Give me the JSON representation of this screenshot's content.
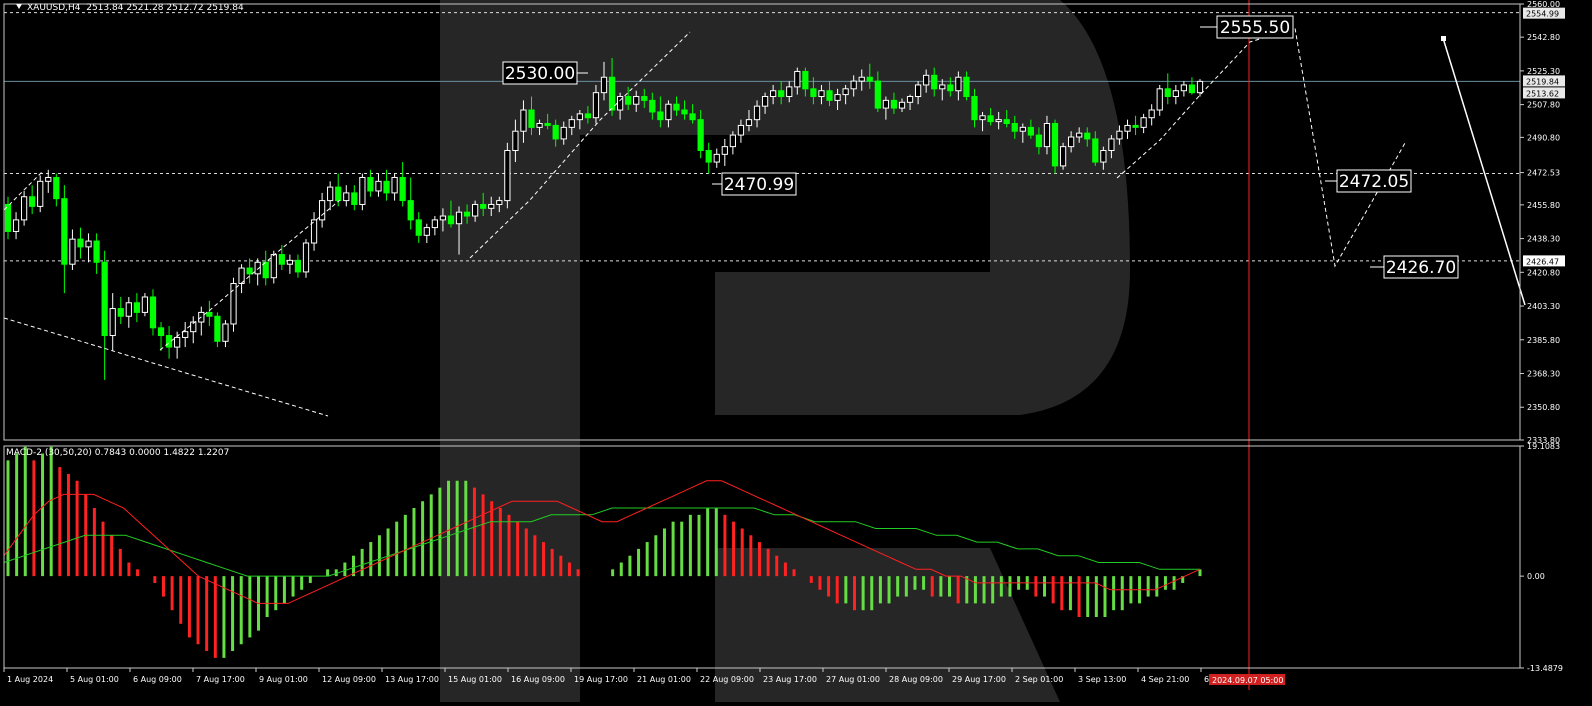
{
  "header": {
    "symbol": "XAUUSD,H4",
    "ohlc": "2513.84 2521.28 2512.72 2519.84"
  },
  "indicator": {
    "label": "MACD-2 (30,50,20) 0.7843 0.0000 1.4822 1.2207"
  },
  "colors": {
    "background": "#000000",
    "bull_candle": "#ffffff",
    "bear_candle": "#00ff00",
    "hist_up": "#66dd44",
    "hist_down": "#ff2222",
    "fast_line": "#ff2020",
    "slow_line": "#22cc22",
    "vertical_line": "#ff2020",
    "watermark": "#262626"
  },
  "chart_data": [
    {
      "type": "candlestick",
      "symbol": "XAUUSD",
      "timeframe": "H4",
      "ylim": [
        2333.8,
        2560.0
      ],
      "price_axis_labels": [
        "2560.00",
        "2542.80",
        "2525.30",
        "2507.80",
        "2490.80",
        "2472.53",
        "2455.80",
        "2438.30",
        "2420.80",
        "2403.30",
        "2385.80",
        "2368.30",
        "2350.80",
        "2333.80"
      ],
      "highlighted_prices": [
        "2554.99",
        "2519.84",
        "2513.62",
        "2426.47"
      ],
      "time_labels": [
        "1 Aug 2024",
        "5 Aug 01:00",
        "6 Aug 09:00",
        "7 Aug 17:00",
        "9 Aug 01:00",
        "12 Aug 09:00",
        "13 Aug 17:00",
        "15 Aug 01:00",
        "16 Aug 09:00",
        "19 Aug 17:00",
        "21 Aug 01:00",
        "22 Aug 09:00",
        "23 Aug 17:00",
        "27 Aug 01:00",
        "28 Aug 09:00",
        "29 Aug 17:00",
        "2 Sep 01:00",
        "3 Sep 13:00",
        "4 Sep 21:00",
        "6 S"
      ],
      "time_label_highlight": "2024.09.07 05:00",
      "price_levels": [
        {
          "label": "2555.50",
          "price": 2555.5
        },
        {
          "label": "2530.00",
          "price": 2530.0
        },
        {
          "label": "2470.99",
          "price": 2470.99
        },
        {
          "label": "2472.05",
          "price": 2472.05
        },
        {
          "label": "2426.70",
          "price": 2426.7
        }
      ],
      "dashed_horizontal_levels": [
        2555.5,
        2472.05,
        2426.7
      ],
      "current_price_line": 2519.84,
      "candles": [
        [
          2456.0,
          2460.0,
          2438.0,
          2442.0
        ],
        [
          2442.0,
          2452.0,
          2438.0,
          2448.0
        ],
        [
          2448.0,
          2463.0,
          2445.0,
          2460.0
        ],
        [
          2460.0,
          2466.0,
          2451.0,
          2455.0
        ],
        [
          2455.0,
          2471.0,
          2452.0,
          2468.0
        ],
        [
          2468.0,
          2474.0,
          2462.0,
          2470.0
        ],
        [
          2470.0,
          2472.0,
          2455.0,
          2459.0
        ],
        [
          2459.0,
          2466.0,
          2410.0,
          2425.0
        ],
        [
          2425.0,
          2443.0,
          2422.0,
          2438.0
        ],
        [
          2438.0,
          2444.0,
          2428.0,
          2434.0
        ],
        [
          2434.0,
          2441.0,
          2426.0,
          2437.0
        ],
        [
          2437.0,
          2441.0,
          2420.0,
          2426.0
        ],
        [
          2426.0,
          2432.0,
          2365.0,
          2388.0
        ],
        [
          2388.0,
          2410.0,
          2380.0,
          2402.0
        ],
        [
          2402.0,
          2408.0,
          2394.0,
          2398.0
        ],
        [
          2398.0,
          2408.0,
          2392.0,
          2405.0
        ],
        [
          2405.0,
          2410.0,
          2395.0,
          2400.0
        ],
        [
          2400.0,
          2410.0,
          2398.0,
          2408.0
        ],
        [
          2408.0,
          2412.0,
          2388.0,
          2392.0
        ],
        [
          2392.0,
          2395.0,
          2380.0,
          2388.0
        ],
        [
          2388.0,
          2393.0,
          2376.0,
          2382.0
        ],
        [
          2382.0,
          2390.0,
          2376.0,
          2387.0
        ],
        [
          2387.0,
          2395.0,
          2382.0,
          2390.0
        ],
        [
          2390.0,
          2398.0,
          2384.0,
          2395.0
        ],
        [
          2395.0,
          2403.0,
          2388.0,
          2400.0
        ],
        [
          2400.0,
          2406.0,
          2393.0,
          2398.0
        ],
        [
          2398.0,
          2400.0,
          2382.0,
          2385.0
        ],
        [
          2385.0,
          2396.0,
          2382.0,
          2394.0
        ],
        [
          2394.0,
          2418.0,
          2390.0,
          2415.0
        ],
        [
          2415.0,
          2425.0,
          2410.0,
          2423.0
        ],
        [
          2423.0,
          2428.0,
          2415.0,
          2420.0
        ],
        [
          2420.0,
          2428.0,
          2414.0,
          2426.0
        ],
        [
          2426.0,
          2432.0,
          2414.0,
          2418.0
        ],
        [
          2418.0,
          2432.0,
          2415.0,
          2430.0
        ],
        [
          2430.0,
          2435.0,
          2422.0,
          2425.0
        ],
        [
          2425.0,
          2430.0,
          2420.0,
          2427.0
        ],
        [
          2427.0,
          2430.0,
          2418.0,
          2421.0
        ],
        [
          2421.0,
          2438.0,
          2418.0,
          2436.0
        ],
        [
          2436.0,
          2452.0,
          2432.0,
          2448.0
        ],
        [
          2448.0,
          2462.0,
          2444.0,
          2458.0
        ],
        [
          2458.0,
          2468.0,
          2453.0,
          2465.0
        ],
        [
          2465.0,
          2472.0,
          2455.0,
          2458.0
        ],
        [
          2458.0,
          2466.0,
          2455.0,
          2462.0
        ],
        [
          2462.0,
          2466.0,
          2453.0,
          2456.0
        ],
        [
          2456.0,
          2472.0,
          2453.0,
          2470.0
        ],
        [
          2470.0,
          2474.0,
          2460.0,
          2463.0
        ],
        [
          2463.0,
          2472.0,
          2460.0,
          2468.0
        ],
        [
          2468.0,
          2474.0,
          2458.0,
          2462.0
        ],
        [
          2462.0,
          2472.0,
          2458.0,
          2470.0
        ],
        [
          2470.0,
          2478.0,
          2455.0,
          2458.0
        ],
        [
          2458.0,
          2470.0,
          2443.0,
          2448.0
        ],
        [
          2448.0,
          2452.0,
          2436.0,
          2440.0
        ],
        [
          2440.0,
          2446.0,
          2436.0,
          2444.0
        ],
        [
          2444.0,
          2450.0,
          2440.0,
          2448.0
        ],
        [
          2448.0,
          2454.0,
          2442.0,
          2450.0
        ],
        [
          2450.0,
          2458.0,
          2444.0,
          2446.0
        ],
        [
          2446.0,
          2455.0,
          2430.0,
          2452.0
        ],
        [
          2452.0,
          2456.0,
          2446.0,
          2450.0
        ],
        [
          2450.0,
          2458.0,
          2447.0,
          2456.0
        ],
        [
          2456.0,
          2462.0,
          2450.0,
          2454.0
        ],
        [
          2454.0,
          2460.0,
          2450.0,
          2456.0
        ],
        [
          2456.0,
          2460.0,
          2452.0,
          2458.0
        ],
        [
          2458.0,
          2488.0,
          2454.0,
          2484.0
        ],
        [
          2484.0,
          2500.0,
          2478.0,
          2494.0
        ],
        [
          2494.0,
          2510.0,
          2488.0,
          2505.0
        ],
        [
          2505.0,
          2512.0,
          2492.0,
          2496.0
        ],
        [
          2496.0,
          2500.0,
          2492.0,
          2498.0
        ],
        [
          2498.0,
          2503.0,
          2495.0,
          2497.0
        ],
        [
          2497.0,
          2500.0,
          2486.0,
          2490.0
        ],
        [
          2490.0,
          2499.0,
          2487.0,
          2496.0
        ],
        [
          2496.0,
          2502.0,
          2492.0,
          2500.0
        ],
        [
          2500.0,
          2505.0,
          2495.0,
          2503.0
        ],
        [
          2503.0,
          2507.0,
          2498.0,
          2501.0
        ],
        [
          2501.0,
          2518.0,
          2498.0,
          2514.0
        ],
        [
          2514.0,
          2530.0,
          2510.0,
          2522.0
        ],
        [
          2522.0,
          2532.0,
          2502.0,
          2505.0
        ],
        [
          2505.0,
          2514.0,
          2500.0,
          2512.0
        ],
        [
          2512.0,
          2517.0,
          2505.0,
          2508.0
        ],
        [
          2508.0,
          2515.0,
          2504.0,
          2512.0
        ],
        [
          2512.0,
          2516.0,
          2506.0,
          2510.0
        ],
        [
          2510.0,
          2514.0,
          2500.0,
          2504.0
        ],
        [
          2504.0,
          2512.0,
          2496.0,
          2500.0
        ],
        [
          2500.0,
          2510.0,
          2496.0,
          2508.0
        ],
        [
          2508.0,
          2512.0,
          2502.0,
          2505.0
        ],
        [
          2505.0,
          2510.0,
          2500.0,
          2503.0
        ],
        [
          2503.0,
          2508.0,
          2498.0,
          2500.0
        ],
        [
          2500.0,
          2505.0,
          2480.0,
          2484.0
        ],
        [
          2484.0,
          2488.0,
          2472.0,
          2478.0
        ],
        [
          2478.0,
          2485.0,
          2475.0,
          2482.0
        ],
        [
          2482.0,
          2490.0,
          2476.0,
          2486.0
        ],
        [
          2486.0,
          2494.0,
          2482.0,
          2492.0
        ],
        [
          2492.0,
          2500.0,
          2488.0,
          2497.0
        ],
        [
          2497.0,
          2505.0,
          2494.0,
          2500.0
        ],
        [
          2500.0,
          2510.0,
          2496.0,
          2507.0
        ],
        [
          2507.0,
          2514.0,
          2503.0,
          2512.0
        ],
        [
          2512.0,
          2518.0,
          2508.0,
          2515.0
        ],
        [
          2515.0,
          2520.0,
          2508.0,
          2512.0
        ],
        [
          2512.0,
          2520.0,
          2509.0,
          2517.0
        ],
        [
          2517.0,
          2527.0,
          2513.0,
          2525.0
        ],
        [
          2525.0,
          2527.0,
          2512.0,
          2516.0
        ],
        [
          2516.0,
          2522.0,
          2508.0,
          2512.0
        ],
        [
          2512.0,
          2518.0,
          2508.0,
          2515.0
        ],
        [
          2515.0,
          2520.0,
          2507.0,
          2510.0
        ],
        [
          2510.0,
          2516.0,
          2505.0,
          2513.0
        ],
        [
          2513.0,
          2518.0,
          2508.0,
          2516.0
        ],
        [
          2516.0,
          2523.0,
          2512.0,
          2520.0
        ],
        [
          2520.0,
          2526.0,
          2515.0,
          2522.0
        ],
        [
          2522.0,
          2529.0,
          2516.0,
          2520.0
        ],
        [
          2520.0,
          2525.0,
          2504.0,
          2506.0
        ],
        [
          2506.0,
          2512.0,
          2500.0,
          2510.0
        ],
        [
          2510.0,
          2514.0,
          2503.0,
          2506.0
        ],
        [
          2506.0,
          2511.0,
          2504.0,
          2509.0
        ],
        [
          2509.0,
          2513.0,
          2505.0,
          2512.0
        ],
        [
          2512.0,
          2520.0,
          2508.0,
          2518.0
        ],
        [
          2518.0,
          2526.0,
          2514.0,
          2523.0
        ],
        [
          2523.0,
          2527.0,
          2512.0,
          2516.0
        ],
        [
          2516.0,
          2521.0,
          2510.0,
          2518.0
        ],
        [
          2518.0,
          2522.0,
          2512.0,
          2515.0
        ],
        [
          2515.0,
          2525.0,
          2510.0,
          2522.0
        ],
        [
          2522.0,
          2525.0,
          2510.0,
          2512.0
        ],
        [
          2512.0,
          2516.0,
          2496.0,
          2500.0
        ],
        [
          2500.0,
          2504.0,
          2494.0,
          2502.0
        ],
        [
          2502.0,
          2506.0,
          2497.0,
          2499.0
        ],
        [
          2499.0,
          2504.0,
          2495.0,
          2500.0
        ],
        [
          2500.0,
          2505.0,
          2496.0,
          2498.0
        ],
        [
          2498.0,
          2502.0,
          2490.0,
          2494.0
        ],
        [
          2494.0,
          2498.0,
          2488.0,
          2496.0
        ],
        [
          2496.0,
          2500.0,
          2490.0,
          2492.0
        ],
        [
          2492.0,
          2496.0,
          2482.0,
          2486.0
        ],
        [
          2486.0,
          2502.0,
          2482.0,
          2498.0
        ],
        [
          2498.0,
          2500.0,
          2472.0,
          2476.0
        ],
        [
          2476.0,
          2488.0,
          2474.0,
          2486.0
        ],
        [
          2486.0,
          2494.0,
          2483.0,
          2491.0
        ],
        [
          2491.0,
          2496.0,
          2488.0,
          2493.0
        ],
        [
          2493.0,
          2496.0,
          2486.0,
          2490.0
        ],
        [
          2490.0,
          2494.0,
          2476.0,
          2478.0
        ],
        [
          2478.0,
          2486.0,
          2474.0,
          2484.0
        ],
        [
          2484.0,
          2492.0,
          2480.0,
          2490.0
        ],
        [
          2490.0,
          2497.0,
          2487.0,
          2494.0
        ],
        [
          2494.0,
          2500.0,
          2490.0,
          2497.0
        ],
        [
          2497.0,
          2502.0,
          2492.0,
          2496.0
        ],
        [
          2496.0,
          2503.0,
          2493.0,
          2501.0
        ],
        [
          2501.0,
          2508.0,
          2497.0,
          2505.0
        ],
        [
          2505.0,
          2518.0,
          2502.0,
          2516.0
        ],
        [
          2516.0,
          2524.0,
          2508.0,
          2512.0
        ],
        [
          2512.0,
          2518.0,
          2508.0,
          2515.0
        ],
        [
          2515.0,
          2520.0,
          2512.0,
          2518.0
        ],
        [
          2518.0,
          2522.0,
          2513.0,
          2514.0
        ],
        [
          2514.0,
          2521.0,
          2512.0,
          2519.84
        ]
      ],
      "candle_encoding": "[open, high, low, close]"
    },
    {
      "type": "macd",
      "name": "MACD-2 (30,50,20)",
      "ylim": [
        -13.4879,
        19.1083
      ],
      "axis_labels": [
        "19.1083",
        "0.00",
        "-13.4879"
      ],
      "histogram": [
        17,
        18,
        19,
        17,
        18,
        19,
        16,
        15,
        14,
        12,
        10,
        8,
        6,
        4,
        2,
        1,
        0,
        -1,
        -3,
        -5,
        -7,
        -9,
        -10,
        -11,
        -12,
        -12,
        -11,
        -10,
        -9,
        -8,
        -6,
        -5,
        -4,
        -3,
        -2,
        -1,
        0,
        1,
        1,
        2,
        3,
        4,
        5,
        6,
        7,
        8,
        9,
        10,
        11,
        12,
        13,
        14,
        14,
        14,
        13,
        12,
        11,
        10,
        9,
        8,
        7,
        6,
        5,
        4,
        3,
        2,
        1,
        0,
        0,
        0,
        1,
        2,
        3,
        4,
        5,
        6,
        7,
        8,
        8,
        9,
        9,
        10,
        10,
        9,
        8,
        7,
        6,
        5,
        4,
        3,
        2,
        1,
        0,
        -1,
        -2,
        -3,
        -4,
        -4,
        -5,
        -5,
        -5,
        -4,
        -4,
        -3,
        -3,
        -2,
        -2,
        -3,
        -3,
        -3,
        -4,
        -4,
        -4,
        -4,
        -4,
        -3,
        -3,
        -2,
        -2,
        -3,
        -3,
        -4,
        -5,
        -5,
        -6,
        -6,
        -6,
        -6,
        -5,
        -5,
        -4,
        -4,
        -3,
        -3,
        -2,
        -2,
        -1,
        0,
        1
      ],
      "fast_line": [
        3,
        6,
        9,
        11,
        12,
        12,
        12,
        11,
        10,
        8,
        6,
        4,
        2,
        0,
        -1,
        -2,
        -3,
        -4,
        -4,
        -4,
        -3,
        -2,
        -1,
        0,
        1,
        2,
        3,
        4,
        5,
        6,
        7,
        8,
        9,
        10,
        11,
        11,
        11,
        11,
        10,
        9,
        8,
        8,
        9,
        10,
        11,
        12,
        13,
        14,
        14,
        13,
        12,
        11,
        10,
        9,
        8,
        7,
        6,
        5,
        4,
        3,
        2,
        1,
        1,
        0,
        0,
        -1,
        -1,
        -1,
        -1,
        -1,
        -1,
        -1,
        -1,
        -1,
        -2,
        -2,
        -2,
        -2,
        -1,
        0,
        1
      ],
      "slow_line": [
        2,
        3,
        4,
        5,
        6,
        6,
        6,
        5,
        4,
        3,
        2,
        1,
        0,
        0,
        0,
        0,
        0,
        1,
        2,
        3,
        4,
        5,
        6,
        7,
        8,
        8,
        8,
        9,
        9,
        9,
        10,
        10,
        10,
        10,
        10,
        10,
        10,
        10,
        9,
        9,
        8,
        8,
        8,
        7,
        7,
        7,
        6,
        6,
        5,
        5,
        4,
        4,
        3,
        3,
        2,
        2,
        2,
        1,
        1,
        1
      ]
    }
  ]
}
